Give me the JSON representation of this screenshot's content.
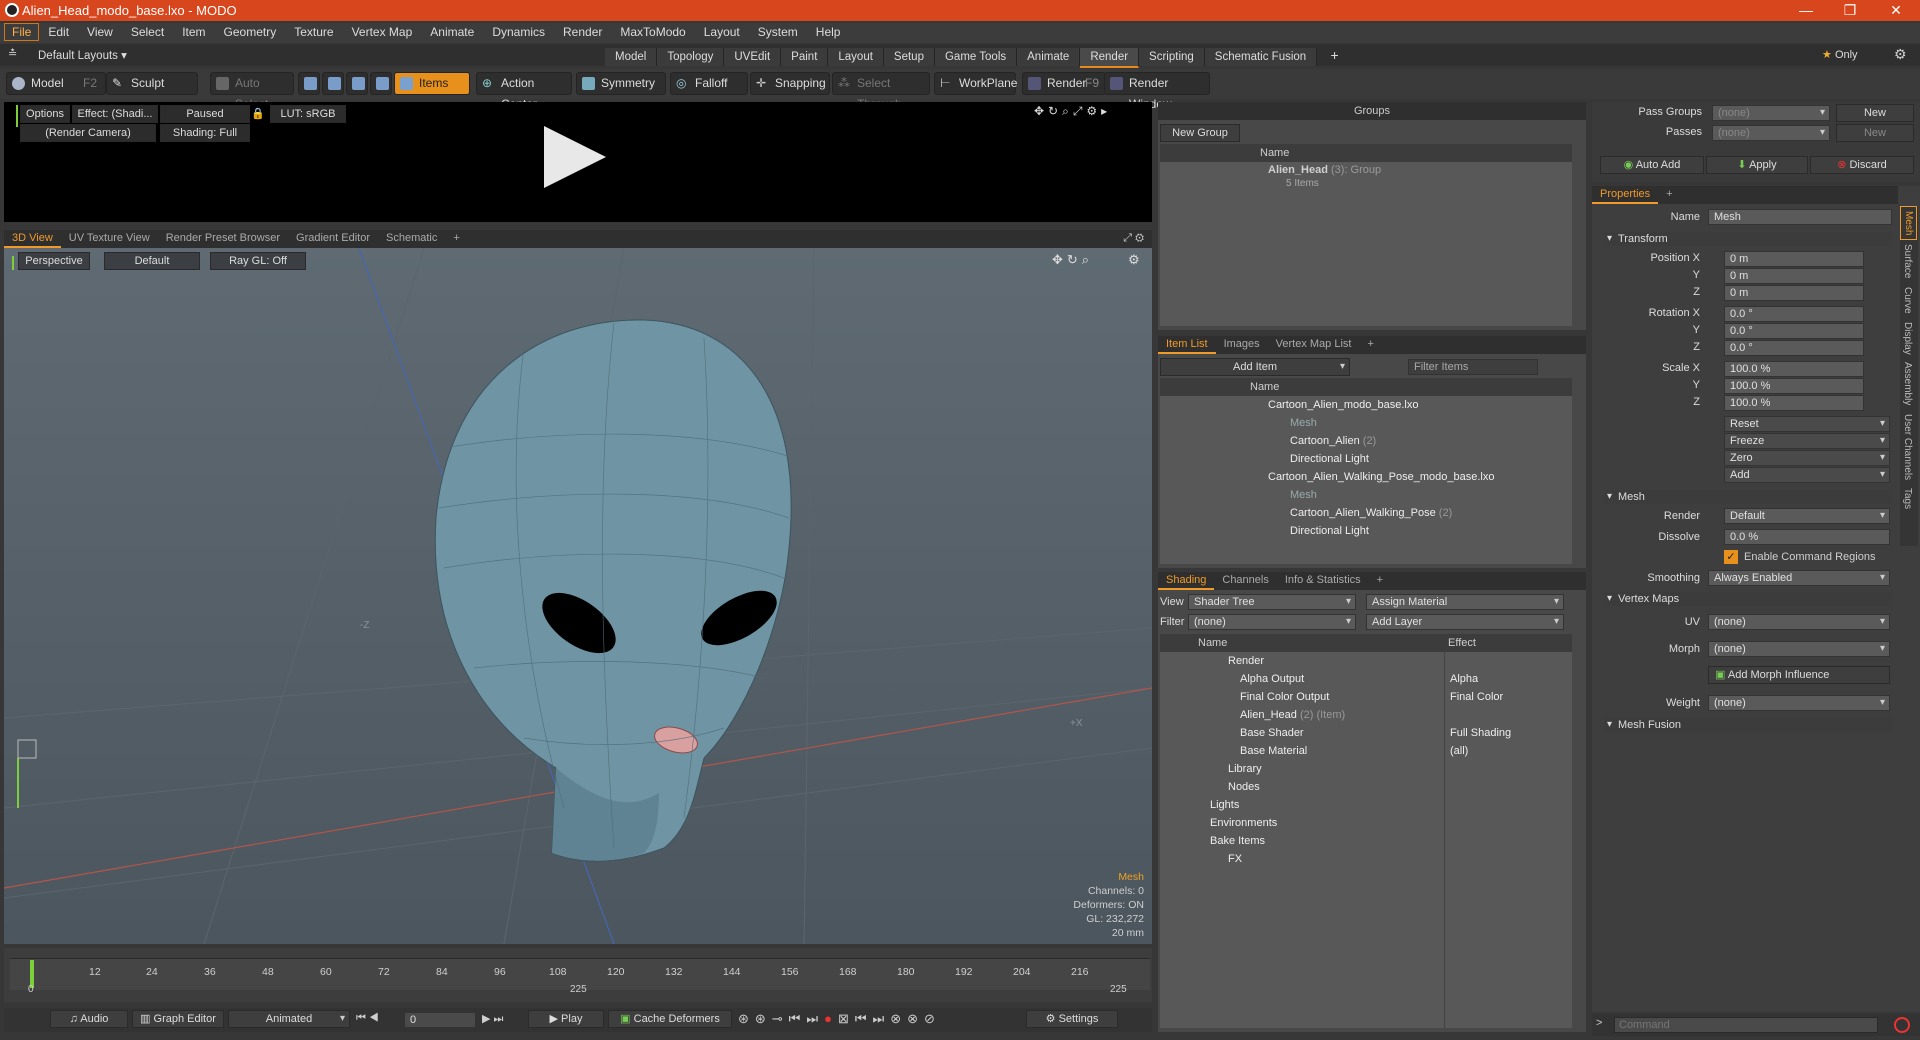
{
  "window": {
    "title": "Alien_Head_modo_base.lxo - MODO"
  },
  "menu": [
    "File",
    "Edit",
    "View",
    "Select",
    "Item",
    "Geometry",
    "Texture",
    "Vertex Map",
    "Animate",
    "Dynamics",
    "Render",
    "MaxToModo",
    "Layout",
    "System",
    "Help"
  ],
  "layouts": {
    "default_label": "Default Layouts",
    "tabs": [
      "Model",
      "Topology",
      "UVEdit",
      "Paint",
      "Layout",
      "Setup",
      "Game Tools",
      "Animate",
      "Render",
      "Scripting",
      "Schematic Fusion"
    ],
    "active": "Render",
    "only_label": "Only"
  },
  "toolbar": {
    "model": "Model",
    "model_key": "F2",
    "sculpt": "Sculpt",
    "auto_select": "Auto Select",
    "items": "Items",
    "action_center": "Action Center",
    "symmetry": "Symmetry",
    "falloff": "Falloff",
    "snapping": "Snapping",
    "select_through": "Select Through",
    "workplane": "WorkPlane",
    "render": "Render",
    "render_key": "F9",
    "render_window": "Render Window"
  },
  "preview": {
    "options": "Options",
    "effect": "Effect: (Shadi...",
    "paused": "Paused",
    "lut": "LUT: sRGB",
    "camera": "(Render Camera)",
    "shading": "Shading: Full"
  },
  "viewtabs": [
    "3D View",
    "UV Texture View",
    "Render Preset Browser",
    "Gradient Editor",
    "Schematic"
  ],
  "viewport": {
    "perspective": "Perspective",
    "default": "Default",
    "raygl": "Ray GL: Off",
    "axis_z": "-Z",
    "axis_x": "+X",
    "info": {
      "mesh": "Mesh",
      "channels": "Channels: 0",
      "deformers": "Deformers: ON",
      "gl": "GL: 232,272",
      "size": "20 mm"
    }
  },
  "timeline": {
    "ticks": [
      "0",
      "12",
      "24",
      "36",
      "48",
      "60",
      "72",
      "84",
      "96",
      "108",
      "120",
      "132",
      "144",
      "156",
      "168",
      "180",
      "192",
      "204",
      "216"
    ],
    "start": "0",
    "end": "225",
    "mid": "225",
    "end_label": "225"
  },
  "transport": {
    "audio": "Audio",
    "graph_editor": "Graph Editor",
    "animated": "Animated",
    "frame": "0",
    "play": "Play",
    "cache": "Cache Deformers",
    "settings": "Settings"
  },
  "groups": {
    "title": "Groups",
    "new_group": "New Group",
    "col_name": "Name",
    "item_name": "Alien_Head",
    "item_count": "(3)",
    "item_type": ": Group",
    "item_sub": "5 Items"
  },
  "itemlist": {
    "tabs": [
      "Item List",
      "Images",
      "Vertex Map List"
    ],
    "add_item": "Add Item",
    "filter": "Filter Items",
    "col_name": "Name",
    "rows": [
      "Cartoon_Alien_modo_base.lxo",
      "Mesh",
      "Cartoon_Alien",
      "(2)",
      "Directional Light",
      "Cartoon_Alien_Walking_Pose_modo_base.lxo",
      "Mesh",
      "Cartoon_Alien_Walking_Pose",
      "(2)",
      "Directional Light"
    ]
  },
  "shading": {
    "tabs": [
      "Shading",
      "Channels",
      "Info & Statistics"
    ],
    "view_label": "View",
    "view_value": "Shader Tree",
    "assign": "Assign Material",
    "filter_label": "Filter",
    "filter_value": "(none)",
    "add_layer": "Add Layer",
    "col_name": "Name",
    "col_effect": "Effect",
    "rows": [
      {
        "name": "Render",
        "effect": ""
      },
      {
        "name": "Alpha Output",
        "effect": "Alpha"
      },
      {
        "name": "Final Color Output",
        "effect": "Final Color"
      },
      {
        "name": "Alien_Head",
        "extra": "(2) (Item)",
        "effect": ""
      },
      {
        "name": "Base Shader",
        "effect": "Full Shading"
      },
      {
        "name": "Base Material",
        "effect": "(all)"
      },
      {
        "name": "Library",
        "effect": ""
      },
      {
        "name": "Nodes",
        "effect": ""
      },
      {
        "name": "Lights",
        "effect": ""
      },
      {
        "name": "Environments",
        "effect": ""
      },
      {
        "name": "Bake Items",
        "effect": ""
      },
      {
        "name": "FX",
        "effect": ""
      }
    ]
  },
  "passes": {
    "pass_groups": "Pass Groups",
    "passes": "Passes",
    "none": "(none)",
    "new": "New",
    "auto_add": "Auto Add",
    "apply": "Apply",
    "discard": "Discard"
  },
  "properties": {
    "tab": "Properties",
    "name_label": "Name",
    "name_value": "Mesh",
    "transform": "Transform",
    "pos_label": "Position X",
    "rot_label": "Rotation X",
    "scale_label": "Scale X",
    "y": "Y",
    "z": "Z",
    "pos": [
      "0 m",
      "0 m",
      "0 m"
    ],
    "rot": [
      "0.0 °",
      "0.0 °",
      "0.0 °"
    ],
    "scale": [
      "100.0 %",
      "100.0 %",
      "100.0 %"
    ],
    "reset": "Reset",
    "freeze": "Freeze",
    "zero": "Zero",
    "add": "Add",
    "mesh": "Mesh",
    "render_label": "Render",
    "render_value": "Default",
    "dissolve_label": "Dissolve",
    "dissolve_value": "0.0 %",
    "enable_cmd": "Enable Command Regions",
    "smoothing_label": "Smoothing",
    "smoothing_value": "Always Enabled",
    "vertex_maps": "Vertex Maps",
    "uv_label": "UV",
    "uv_value": "(none)",
    "morph_label": "Morph",
    "morph_value": "(none)",
    "add_morph": "Add Morph Influence",
    "weight_label": "Weight",
    "weight_value": "(none)",
    "mesh_fusion": "Mesh Fusion",
    "side_tabs": [
      "Mesh",
      "Surface",
      "Curve",
      "Display",
      "Assembly",
      "User Channels",
      "Tags"
    ]
  },
  "command": {
    "placeholder": "Command"
  }
}
